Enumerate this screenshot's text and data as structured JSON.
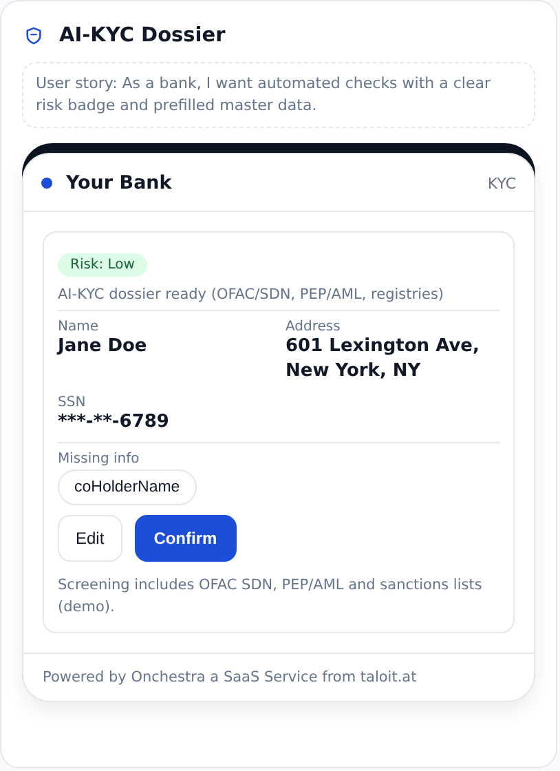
{
  "header": {
    "title": "AI-KYC Dossier"
  },
  "user_story": "User story: As a bank, I want automated checks with a clear risk badge and prefilled master data.",
  "app": {
    "bank": "Your Bank",
    "tag": "KYC",
    "risk_badge": {
      "text": "Risk: Low",
      "color": "#dcfce7"
    },
    "status": "AI-KYC dossier ready (OFAC/SDN, PEP/AML, registries)",
    "fields": [
      {
        "label": "Name",
        "value": "Jane Doe"
      },
      {
        "label": "Address",
        "value": "601 Lexington Ave, New York, NY"
      },
      {
        "label": "SSN",
        "value": "***-**-6789"
      }
    ],
    "missing_label": "Missing info",
    "missing": [
      "coHolderName"
    ],
    "buttons": [
      {
        "label": "Edit",
        "kind": "secondary"
      },
      {
        "label": "Confirm",
        "kind": "primary"
      }
    ],
    "note": "Screening includes OFAC SDN, PEP/AML and sanctions lists (demo).",
    "footer": "Powered by Onchestra a SaaS Service from taloit.at"
  }
}
